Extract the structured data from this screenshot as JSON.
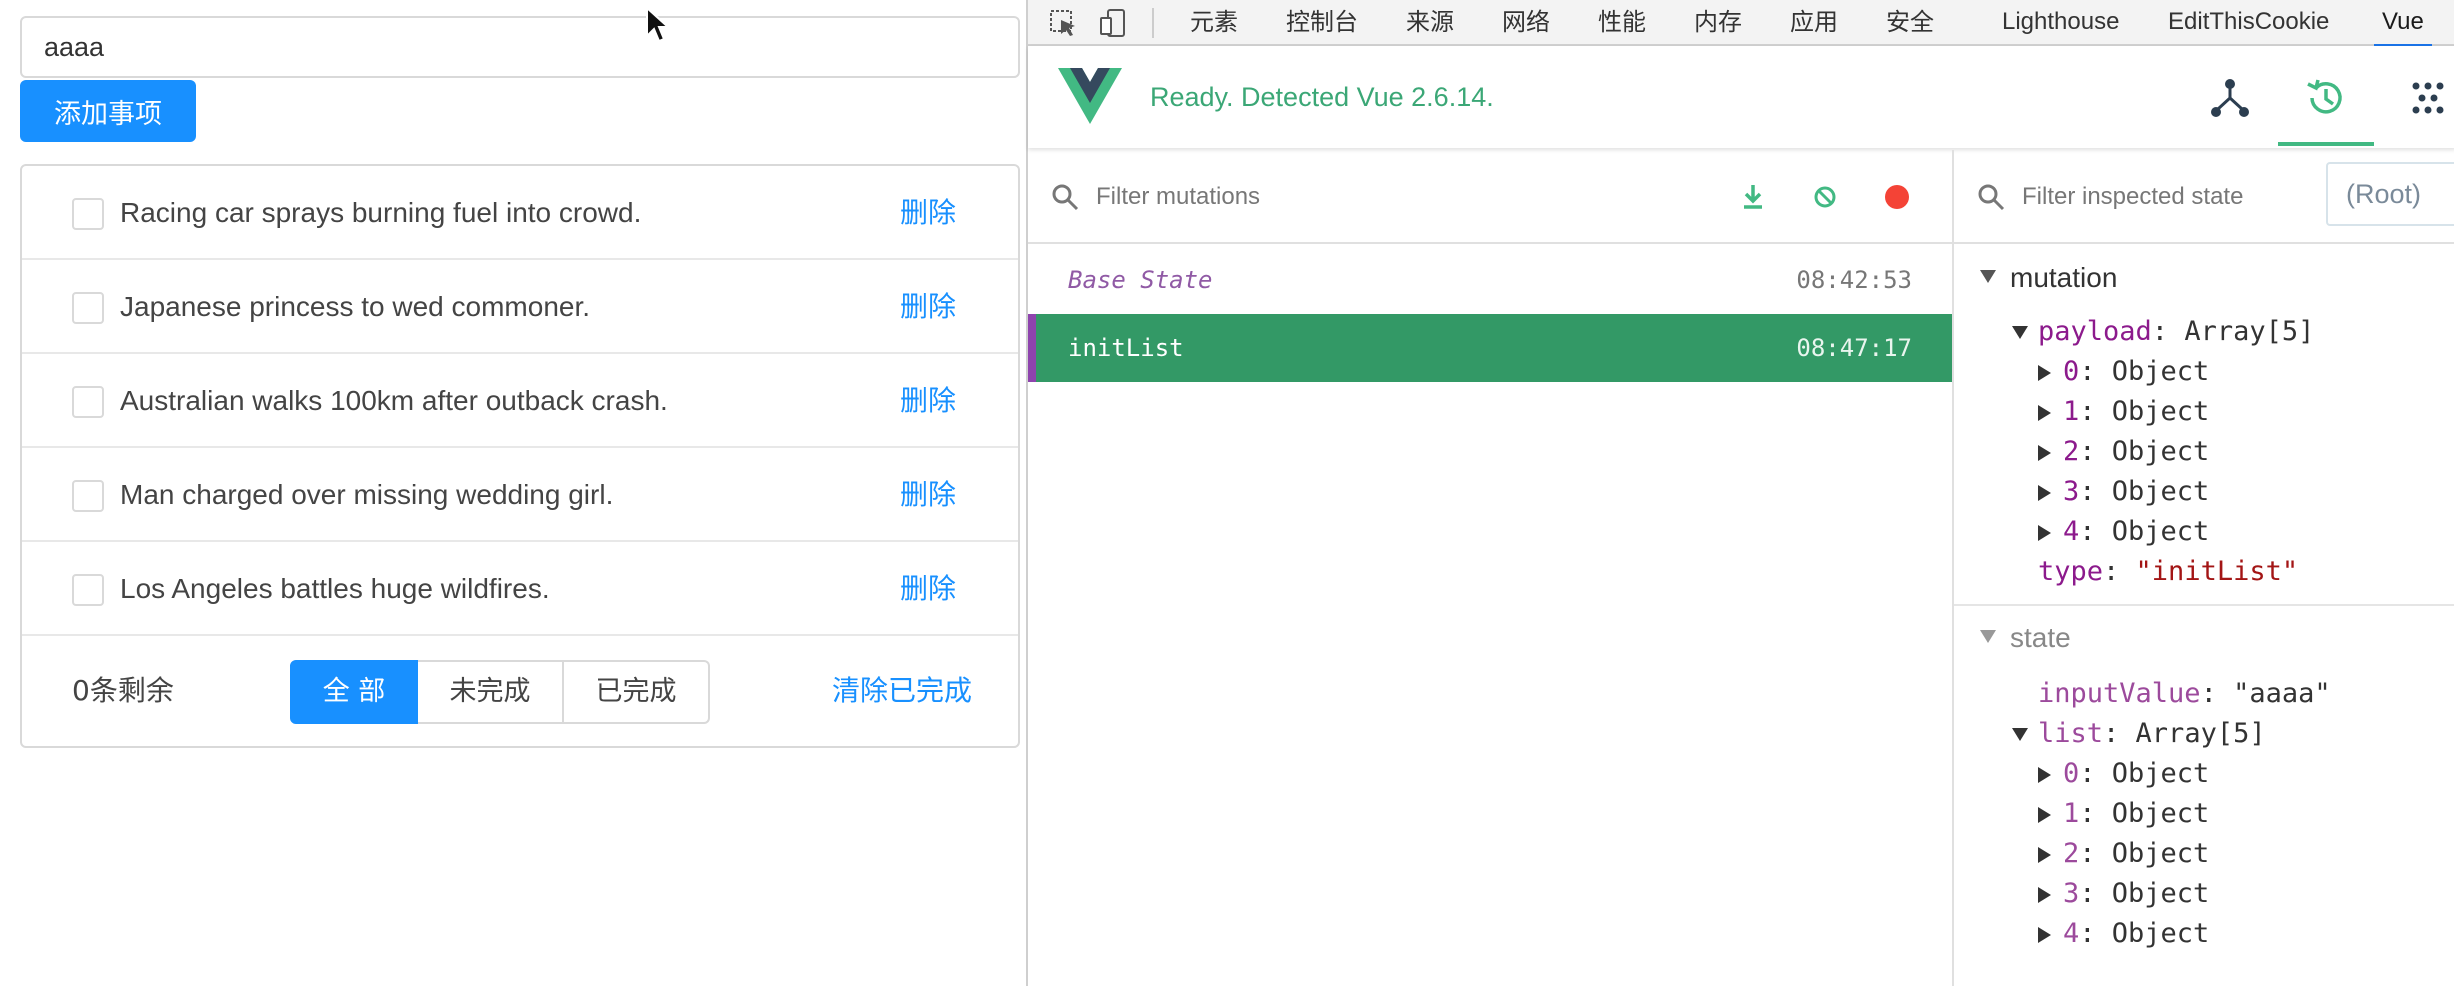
{
  "app": {
    "input_value": "aaaa",
    "add_button": "添加事项",
    "todos": [
      {
        "text": "Racing car sprays burning fuel into crowd.",
        "delete": "删除"
      },
      {
        "text": "Japanese princess to wed commoner.",
        "delete": "删除"
      },
      {
        "text": "Australian walks 100km after outback crash.",
        "delete": "删除"
      },
      {
        "text": "Man charged over missing wedding girl.",
        "delete": "删除"
      },
      {
        "text": "Los Angeles battles huge wildfires.",
        "delete": "删除"
      }
    ],
    "footer": {
      "remaining": "0条剩余",
      "filters": [
        "全 部",
        "未完成",
        "已完成"
      ],
      "active_filter": "全 部",
      "clear_completed": "清除已完成"
    }
  },
  "devtools": {
    "tabs": [
      "元素",
      "控制台",
      "来源",
      "网络",
      "性能",
      "内存",
      "应用",
      "安全",
      "Lighthouse",
      "EditThisCookie",
      "Vue"
    ],
    "active_tab": "Vue",
    "status": "Ready. Detected Vue 2.6.14.",
    "mutations": {
      "filter_placeholder": "Filter mutations",
      "rows": [
        {
          "name": "Base State",
          "time": "08:42:53"
        },
        {
          "name": "initList",
          "time": "08:47:17"
        }
      ]
    },
    "inspector": {
      "filter_placeholder": "Filter inspected state",
      "root_select": "(Root)",
      "mutation_section": "mutation",
      "payload_key": "payload",
      "payload_type": "Array[5]",
      "payload_items": [
        "0",
        "1",
        "2",
        "3",
        "4"
      ],
      "object_label": "Object",
      "type_key": "type",
      "type_value": "\"initList\"",
      "state_section": "state",
      "input_key": "inputValue",
      "input_value": "\"aaaa\"",
      "list_key": "list",
      "list_type": "Array[5]",
      "list_items": [
        "0",
        "1",
        "2",
        "3",
        "4"
      ]
    },
    "colors": {
      "vue_green": "#42b983",
      "selected_row": "#339966",
      "accent_blue": "#1890ff"
    }
  }
}
